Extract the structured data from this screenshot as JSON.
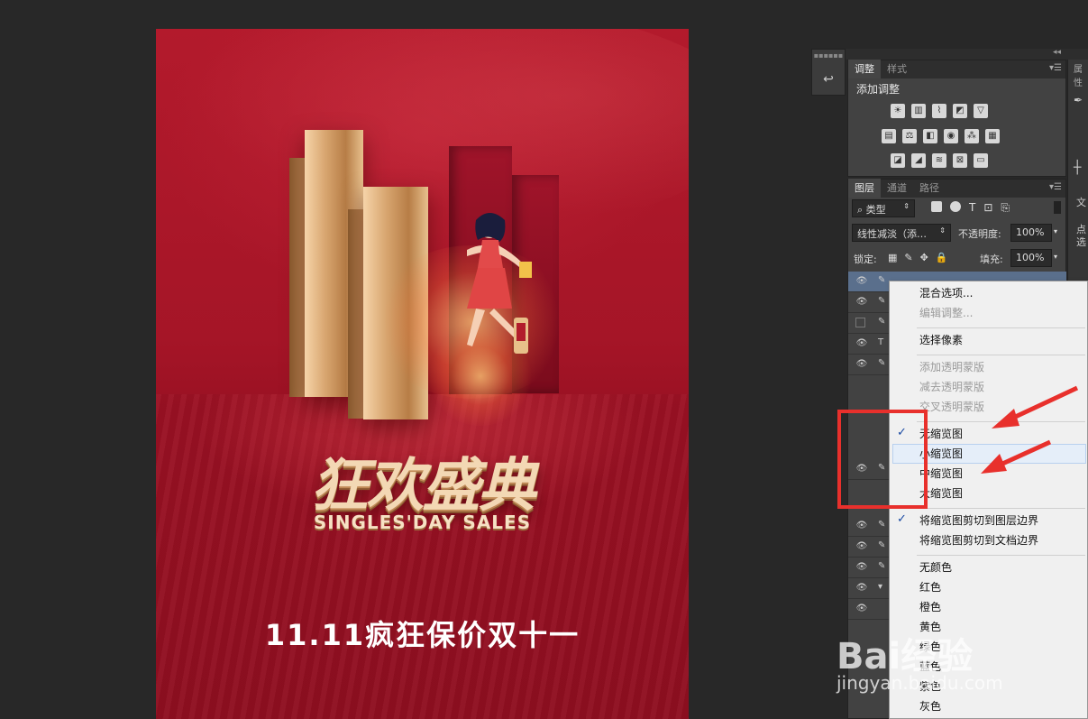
{
  "poster": {
    "title": "狂欢盛典",
    "subtitle": "SINGLES'DAY SALES",
    "tagline": "11.11疯狂保价双十一"
  },
  "adjustments_panel": {
    "tabs": [
      "调整",
      "样式"
    ],
    "heading": "添加调整",
    "icon_rows": [
      [
        "brightness-icon",
        "levels-icon",
        "curves-icon",
        "exposure-icon",
        "vibrance-icon"
      ],
      [
        "hue-saturation-icon",
        "color-balance-icon",
        "black-white-icon",
        "photo-filter-icon",
        "channel-mixer-icon",
        "color-lookup-icon"
      ],
      [
        "invert-icon",
        "posterize-icon",
        "threshold-icon",
        "selective-color-icon",
        "gradient-map-icon"
      ]
    ]
  },
  "layers_panel": {
    "tabs": [
      "图层",
      "通道",
      "路径"
    ],
    "filter_label": "类型",
    "blend_mode": "线性减淡（添…",
    "opacity_label": "不透明度:",
    "opacity_value": "100%",
    "lock_label": "锁定:",
    "fill_label": "填充:",
    "fill_value": "100%"
  },
  "right_strip": {
    "tab": "属性",
    "labels": [
      "文",
      "点",
      "选"
    ]
  },
  "context_menu": {
    "items": [
      {
        "label": "混合选项...",
        "enabled": true
      },
      {
        "label": "编辑调整...",
        "enabled": false
      },
      {
        "label": "选择像素",
        "enabled": true
      },
      {
        "label": "添加透明蒙版",
        "enabled": false
      },
      {
        "label": "减去透明蒙版",
        "enabled": false
      },
      {
        "label": "交叉透明蒙版",
        "enabled": false
      },
      {
        "label": "无缩览图",
        "enabled": true,
        "checked": true
      },
      {
        "label": "小缩览图",
        "enabled": true,
        "hovered": true
      },
      {
        "label": "中缩览图",
        "enabled": true
      },
      {
        "label": "大缩览图",
        "enabled": true
      },
      {
        "label": "将缩览图剪切到图层边界",
        "enabled": true,
        "checked": true
      },
      {
        "label": "将缩览图剪切到文档边界",
        "enabled": true
      },
      {
        "label": "无颜色",
        "enabled": true
      },
      {
        "label": "红色",
        "enabled": true
      },
      {
        "label": "橙色",
        "enabled": true
      },
      {
        "label": "黄色",
        "enabled": true
      },
      {
        "label": "绿色",
        "enabled": true
      },
      {
        "label": "蓝色",
        "enabled": true
      },
      {
        "label": "紫色",
        "enabled": true
      },
      {
        "label": "灰色",
        "enabled": true
      }
    ]
  },
  "watermark": {
    "logo": "Bai经验",
    "url": "jingyan.baidu.com"
  },
  "colors": {
    "annotation_red": "#e8302c",
    "poster_red": "#a51527",
    "gold": "#d8a670"
  }
}
